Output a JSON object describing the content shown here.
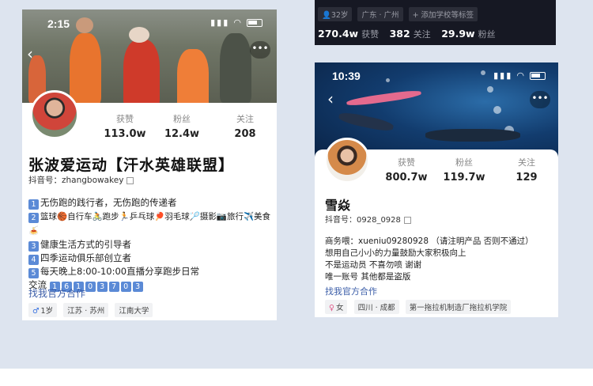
{
  "left_profile": {
    "status_time": "2:15",
    "stats": [
      {
        "label": "获赞",
        "value": "113.0w"
      },
      {
        "label": "粉丝",
        "value": "12.4w"
      },
      {
        "label": "关注",
        "value": "208"
      }
    ],
    "name": "张波爱运动【汗水英雄联盟】",
    "handle": "抖音号：zhangbowakey",
    "bio": [
      {
        "num": "1",
        "text": "无伤跑的践行者，无伤跑的传递者"
      },
      {
        "num": "2",
        "text": "篮球🏀自行车🚴跑步🏃乒乓球🏓羽毛球🏸摄影📷旅行✈️美食🍝"
      },
      {
        "num": "3",
        "text": "健康生活方式的引导者"
      },
      {
        "num": "4",
        "text": "四季运动俱乐部创立者"
      },
      {
        "num": "5",
        "text": "每天晚上8:00-10:00直播分享跑步日常"
      }
    ],
    "contact_label": "交流",
    "contact_digits": [
      "1",
      "6",
      "1",
      "0",
      "3",
      "7",
      "0",
      "3"
    ],
    "collab_link": "找我官方合作",
    "tags": [
      "1岁",
      "江苏 · 苏州",
      "江南大学"
    ]
  },
  "dark_strip": {
    "tags": [
      "32岁",
      "广东 · 广州",
      "+ 添加学校等标签"
    ],
    "stats": [
      {
        "value": "270.4w",
        "label": "获赞"
      },
      {
        "value": "382",
        "label": "关注"
      },
      {
        "value": "29.9w",
        "label": "粉丝"
      }
    ]
  },
  "right_profile": {
    "status_time": "10:39",
    "stats": [
      {
        "label": "获赞",
        "value": "800.7w"
      },
      {
        "label": "粉丝",
        "value": "119.7w"
      },
      {
        "label": "关注",
        "value": "129"
      }
    ],
    "name": "雪焱",
    "handle": "抖音号：0928_0928",
    "bio": [
      "商务喂：xueniu09280928 （请注明产品 否则不通过）",
      "想用自己小小的力量鼓励大家积极向上",
      "不是运动员 不喜勿喷 谢谢",
      "唯一账号 其他都是盗版"
    ],
    "collab_link": "找我官方合作",
    "tags": [
      "女",
      "四川 · 成都",
      "第一拖拉机制造厂拖拉机学院"
    ]
  },
  "colors": {
    "background": "#dde4ef",
    "link": "#3b5da8",
    "badge": "#5b8ad6",
    "dark_strip": "#161823"
  }
}
